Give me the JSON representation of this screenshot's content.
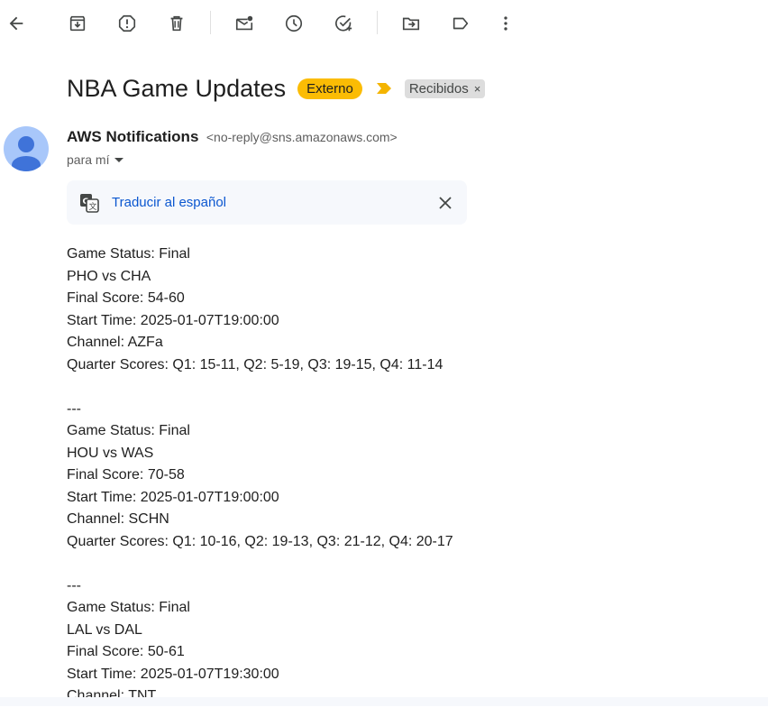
{
  "toolbar": {
    "icons": [
      "back-arrow-icon",
      "archive-icon",
      "report-spam-icon",
      "delete-icon",
      "mark-unread-icon",
      "snooze-icon",
      "add-to-tasks-icon",
      "move-to-icon",
      "label-icon",
      "more-options-icon"
    ]
  },
  "subject": "NBA Game Updates",
  "badge_external": "Externo",
  "label_chip": "Recibidos",
  "label_chip_remove": "×",
  "sender": {
    "name": "AWS Notifications",
    "email": "<no-reply@sns.amazonaws.com>",
    "to": "para mí"
  },
  "translate": {
    "link": "Traducir al español"
  },
  "body_lines": [
    "Game Status: Final",
    "PHO vs CHA",
    "Final Score: 54-60",
    "Start Time: 2025-01-07T19:00:00",
    "Channel: AZFa",
    "Quarter Scores: Q1: 15-11, Q2: 5-19, Q3: 19-15, Q4: 11-14",
    "",
    "---",
    "Game Status: Final",
    "HOU vs WAS",
    "Final Score: 70-58",
    "Start Time: 2025-01-07T19:00:00",
    "Channel: SCHN",
    "Quarter Scores: Q1: 10-16, Q2: 19-13, Q3: 21-12, Q4: 20-17",
    "",
    "---",
    "Game Status: Final",
    "LAL vs DAL",
    "Final Score: 50-61",
    "Start Time: 2025-01-07T19:30:00",
    "Channel: TNT"
  ],
  "colors": {
    "external_badge": "#fbbc04",
    "importance_marker": "#f4b400",
    "link": "#0b57d0",
    "avatar_bg": "#a8c7fa",
    "avatar_fg": "#3f73d9"
  }
}
